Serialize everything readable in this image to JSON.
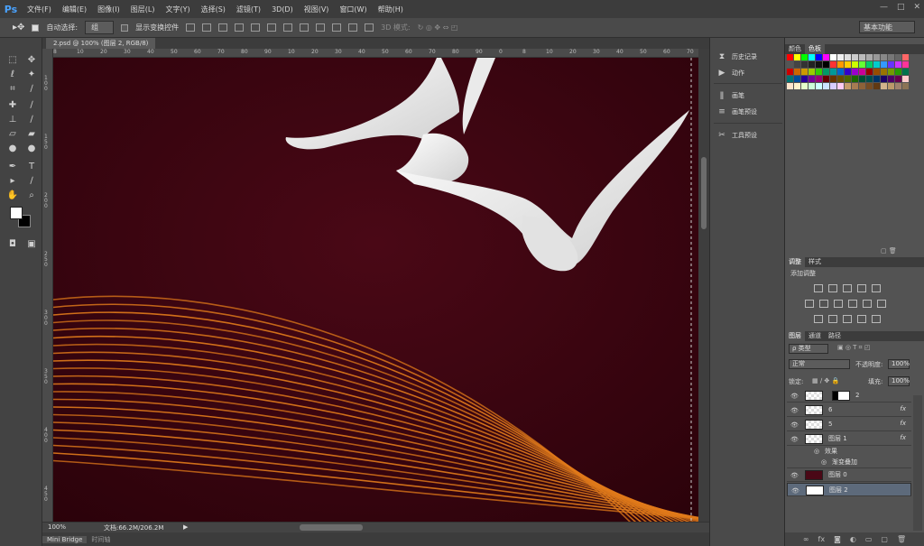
{
  "app": {
    "logo": "Ps",
    "window_controls": [
      "—",
      "□",
      "✕"
    ]
  },
  "menu": [
    "文件(F)",
    "编辑(E)",
    "图像(I)",
    "图层(L)",
    "文字(Y)",
    "选择(S)",
    "滤镜(T)",
    "3D(D)",
    "视图(V)",
    "窗口(W)",
    "帮助(H)"
  ],
  "options": {
    "auto_select_label": "自动选择:",
    "auto_select_value": "组",
    "show_transform_label": "显示变换控件",
    "mode_3d_label": "3D 模式:",
    "workspace": "基本功能"
  },
  "document": {
    "tab_label": "2.psd @ 100% (图层 2, RGB/8)",
    "ruler_top": [
      "8",
      "10",
      "20",
      "30",
      "40",
      "50",
      "60",
      "70",
      "80",
      "90",
      "10",
      "20",
      "30",
      "40",
      "50",
      "60",
      "70",
      "80",
      "90",
      "0",
      "8",
      "10",
      "20",
      "30",
      "40",
      "50",
      "60",
      "70"
    ],
    "zoom": "100%",
    "doc_info": "文档:66.2M/206.2M"
  },
  "bottom_tabs": [
    "Mini Bridge",
    "时间轴"
  ],
  "mid_panel": {
    "items": [
      {
        "label": "历史记录",
        "icon": "history-icon"
      },
      {
        "label": "动作",
        "icon": "actions-play-icon"
      },
      {
        "label": "画笔",
        "icon": "brush-icon"
      },
      {
        "label": "画笔预设",
        "icon": "brush-presets-icon"
      },
      {
        "label": "工具预设",
        "icon": "tool-presets-icon"
      }
    ]
  },
  "swatch_panel": {
    "tabs": [
      "颜色",
      "色板"
    ],
    "active_tab": "色板"
  },
  "adjust_panel": {
    "tabs": [
      "调整",
      "样式"
    ],
    "title": "添加调整"
  },
  "layers_panel": {
    "tabs": [
      "图层",
      "通道",
      "路径"
    ],
    "kind_filter": "ρ 类型",
    "blend_mode": "正常",
    "opacity_label": "不透明度:",
    "opacity_value": "100%",
    "lock_label": "锁定:",
    "fill_label": "填充:",
    "fill_value": "100%",
    "layers": [
      {
        "name": "2",
        "fx": false,
        "selected": false
      },
      {
        "name": "6",
        "fx": true,
        "selected": false
      },
      {
        "name": "5",
        "fx": true,
        "selected": false
      },
      {
        "name": "图层 1",
        "fx": true,
        "selected": false
      },
      {
        "name": "效果",
        "sub": true
      },
      {
        "name": "渐变叠加",
        "sub": true
      },
      {
        "name": "图层 0",
        "fx": false,
        "selected": false
      },
      {
        "name": "图层 2",
        "fx": false,
        "selected": true
      }
    ],
    "fx_label": "fx"
  },
  "colors": {
    "canvas_bg": "#3a0410",
    "accent_lines": "#e07a1a",
    "selection": "#5d6a7b"
  }
}
